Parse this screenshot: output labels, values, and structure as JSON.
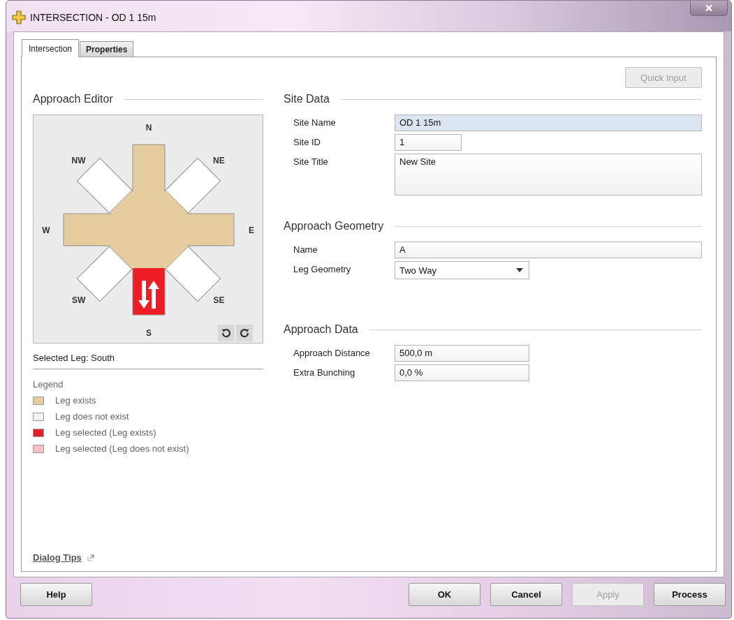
{
  "window": {
    "title": "INTERSECTION - OD 1 15m"
  },
  "tabs": [
    {
      "label": "Intersection",
      "selected": true
    },
    {
      "label": "Properties",
      "selected": false
    }
  ],
  "quick_input": {
    "label": "Quick Input",
    "disabled": true
  },
  "approach_editor": {
    "title": "Approach Editor",
    "selected_leg": "Selected Leg: South",
    "legs": [
      {
        "label": "N",
        "exists": true,
        "selected": false
      },
      {
        "label": "NE",
        "exists": false,
        "selected": false
      },
      {
        "label": "E",
        "exists": true,
        "selected": false
      },
      {
        "label": "SE",
        "exists": false,
        "selected": false
      },
      {
        "label": "S",
        "exists": true,
        "selected": true
      },
      {
        "label": "SW",
        "exists": false,
        "selected": false
      },
      {
        "label": "W",
        "exists": true,
        "selected": false
      },
      {
        "label": "NW",
        "exists": false,
        "selected": false
      }
    ]
  },
  "legend": {
    "title": "Legend",
    "items": [
      {
        "label": "Leg exists",
        "color": "#e6cda0"
      },
      {
        "label": "Leg does not exist",
        "color": "#f2f2f2"
      },
      {
        "label": "Leg selected (Leg exists)",
        "color": "#e3202a"
      },
      {
        "label": "Leg selected (Leg does not exist)",
        "color": "#f9bfc8"
      }
    ]
  },
  "dialog_tips": "Dialog Tips",
  "sections": [
    {
      "title": "Site Data",
      "fields": [
        {
          "label": "Site Name",
          "value": "OD 1 15m",
          "kind": "wide",
          "focused": true
        },
        {
          "label": "Site ID",
          "value": "1",
          "kind": "narrow",
          "focused": false
        },
        {
          "label": "Site Title",
          "value": "New Site",
          "kind": "multiline",
          "focused": false
        }
      ]
    },
    {
      "title": "Approach Geometry",
      "fields": [
        {
          "label": "Name",
          "value": "A",
          "kind": "wide",
          "focused": false
        },
        {
          "label": "Leg Geometry",
          "value": "Two Way",
          "kind": "dropdown",
          "focused": false
        }
      ]
    },
    {
      "title": "Approach Data",
      "fields": [
        {
          "label": "Approach Distance",
          "value": "500,0 m",
          "kind": "short",
          "focused": false
        },
        {
          "label": "Extra Bunching",
          "value": "0,0 %",
          "kind": "short",
          "focused": false
        }
      ]
    }
  ],
  "help_button": {
    "label": "Help",
    "disabled": false
  },
  "buttons": [
    {
      "label": "OK",
      "disabled": false
    },
    {
      "label": "Cancel",
      "disabled": false
    },
    {
      "label": "Apply",
      "disabled": true
    },
    {
      "label": "Process",
      "disabled": false
    }
  ]
}
